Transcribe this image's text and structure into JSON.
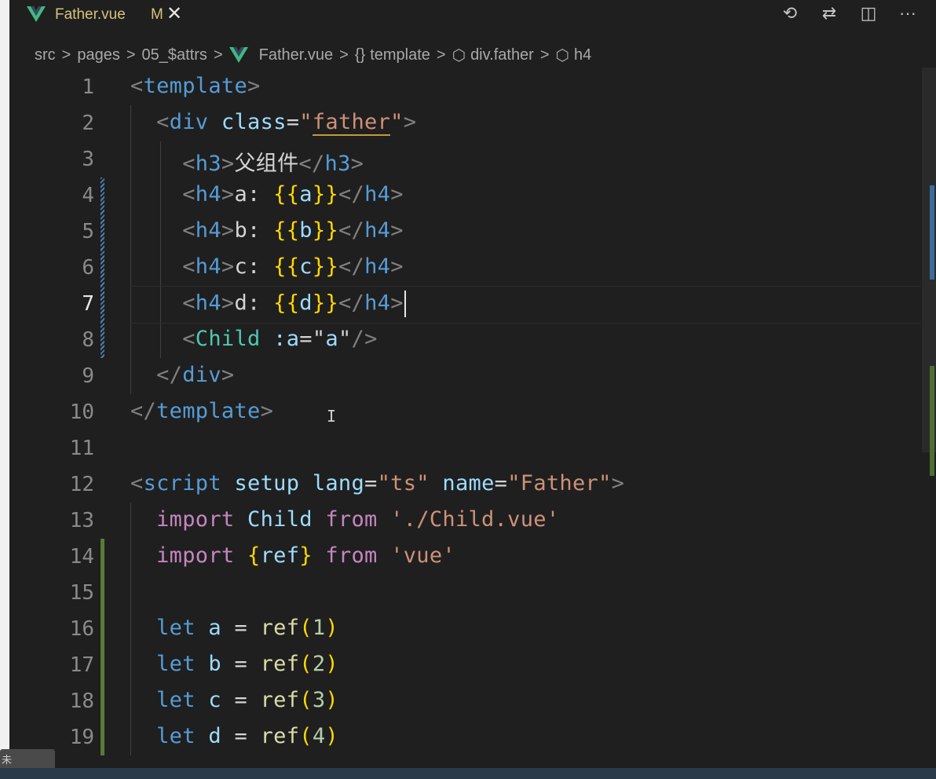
{
  "tab": {
    "label": "Father.vue",
    "modified": "M",
    "close": "✕"
  },
  "toolbar": {
    "history": "⟲",
    "compare": "⇄",
    "split": "◫",
    "more": "···"
  },
  "breadcrumb": {
    "items": [
      "src",
      "pages",
      "05_$attrs",
      "Father.vue",
      "template",
      "div.father",
      "h4"
    ],
    "template_icon": "{}",
    "element_icon": "⬡",
    "separator": ">"
  },
  "editor": {
    "active_line": 7,
    "lines": [
      {
        "n": "1",
        "code": "<template>"
      },
      {
        "n": "2",
        "code": "  <div class=\"father\">"
      },
      {
        "n": "3",
        "code": "    <h3>父组件</h3>"
      },
      {
        "n": "4",
        "code": "    <h4>a: {{a}}</h4>"
      },
      {
        "n": "5",
        "code": "    <h4>b: {{b}}</h4>"
      },
      {
        "n": "6",
        "code": "    <h4>c: {{c}}</h4>"
      },
      {
        "n": "7",
        "code": "    <h4>d: {{d}}</h4>"
      },
      {
        "n": "8",
        "code": "    <Child :a=\"a\"/>"
      },
      {
        "n": "9",
        "code": "  </div>"
      },
      {
        "n": "10",
        "code": "</template>"
      },
      {
        "n": "11",
        "code": ""
      },
      {
        "n": "12",
        "code": "<script setup lang=\"ts\" name=\"Father\">"
      },
      {
        "n": "13",
        "code": "  import Child from './Child.vue'"
      },
      {
        "n": "14",
        "code": "  import {ref} from 'vue'"
      },
      {
        "n": "15",
        "code": ""
      },
      {
        "n": "16",
        "code": "  let a = ref(1)"
      },
      {
        "n": "17",
        "code": "  let b = ref(2)"
      },
      {
        "n": "18",
        "code": "  let c = ref(3)"
      },
      {
        "n": "19",
        "code": "  let d = ref(4)"
      }
    ]
  },
  "toast": {
    "text": "未"
  },
  "colors": {
    "tag": "#569cd6",
    "attribute": "#9cdcfe",
    "string": "#ce9178",
    "keyword": "#c586c0",
    "function": "#dcdcaa",
    "number": "#b5cea8",
    "bracket": "#ffd700",
    "component": "#4ec9b0",
    "modified_tab": "#d8c27a"
  }
}
